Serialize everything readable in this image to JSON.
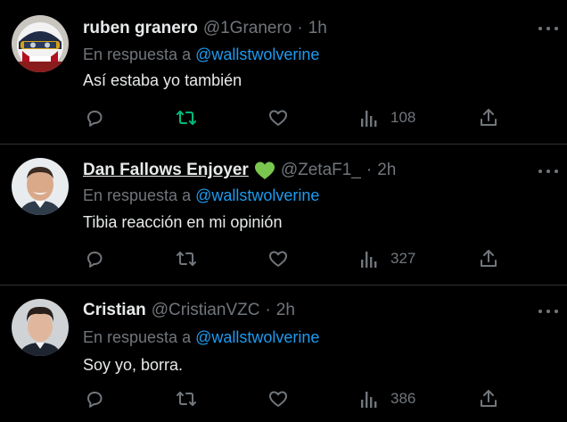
{
  "tweets": [
    {
      "name": "ruben granero",
      "handle": "@1Granero",
      "time": "1h",
      "reply_prefix": "En respuesta a",
      "reply_to": "@wallstwolverine",
      "text": "Así estaba yo también",
      "views": "108",
      "retweet_color": "#00ba7c",
      "avatar_icon": "helmet-avatar"
    },
    {
      "name": "Dan Fallows Enjoyer",
      "badge": "green-heart-icon",
      "handle": "@ZetaF1_",
      "time": "2h",
      "reply_prefix": "En respuesta a",
      "reply_to": "@wallstwolverine",
      "text": "Tibia reacción en mi opinión",
      "views": "327",
      "avatar_icon": "man-avatar"
    },
    {
      "name": "Cristian",
      "handle": "@CristianVZC",
      "time": "2h",
      "reply_prefix": "En respuesta a",
      "reply_to": "@wallstwolverine",
      "text": "Soy yo, borra.",
      "views": "386",
      "avatar_icon": "man-avatar"
    }
  ],
  "colors": {
    "background": "#000000",
    "text": "#e7e9ea",
    "muted": "#71767b",
    "link": "#1d9bf0",
    "divider": "#2f3336",
    "heart_badge": "#7ac74f"
  }
}
